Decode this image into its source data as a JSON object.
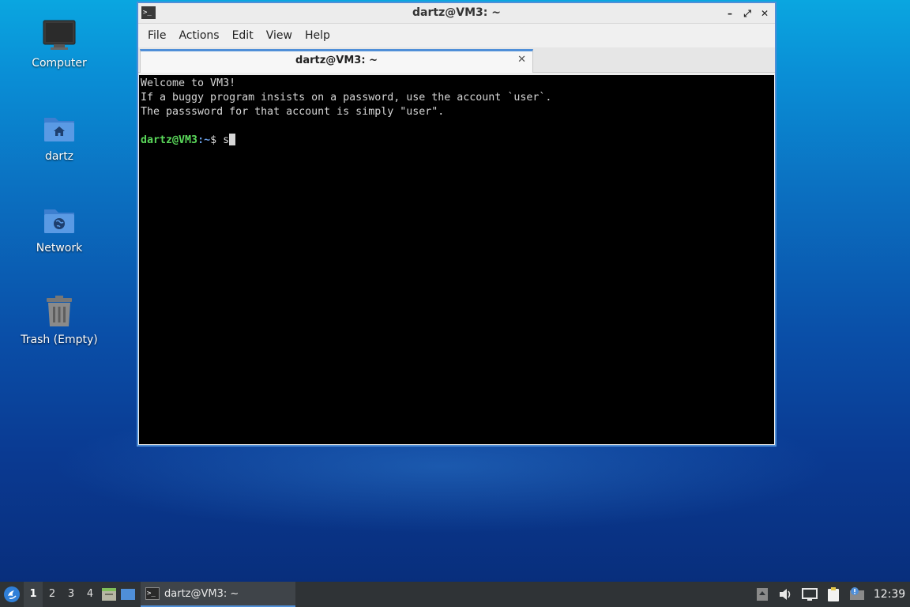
{
  "desktop": {
    "icons": [
      {
        "label": "Computer",
        "icon": "computer-icon"
      },
      {
        "label": "dartz",
        "icon": "home-folder-icon"
      },
      {
        "label": "Network",
        "icon": "network-folder-icon"
      },
      {
        "label": "Trash (Empty)",
        "icon": "trash-icon"
      }
    ]
  },
  "window": {
    "title": "dartz@VM3: ~",
    "menu": [
      "File",
      "Actions",
      "Edit",
      "View",
      "Help"
    ],
    "tab_title": "dartz@VM3: ~",
    "terminal": {
      "lines": [
        "Welcome to VM3!",
        "If a buggy program insists on a password, use the account `user`.",
        "The passsword for that account is simply \"user\"."
      ],
      "prompt_user": "dartz@VM3",
      "prompt_path": ":~",
      "prompt_symbol": "$ ",
      "input": "s"
    }
  },
  "taskbar": {
    "workspaces": [
      "1",
      "2",
      "3",
      "4"
    ],
    "active_workspace": "1",
    "task_label": "dartz@VM3: ~",
    "clock": "12:39"
  },
  "colors": {
    "accent": "#4f8fd8",
    "prompt_user": "#5ad85a",
    "taskbar_bg": "#2f3336"
  }
}
